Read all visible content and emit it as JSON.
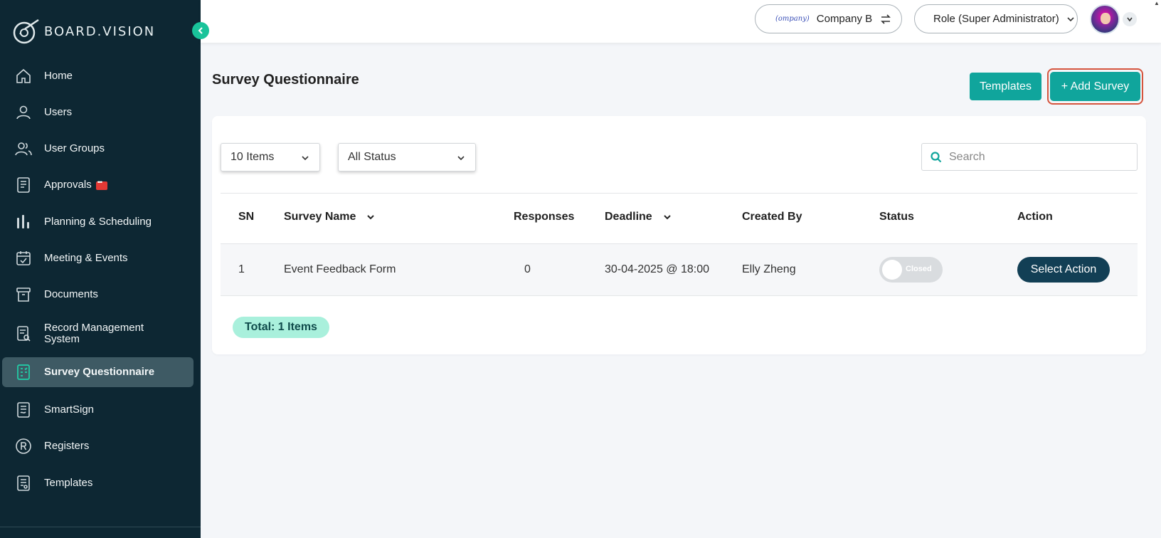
{
  "brand": {
    "name": "BOARD.VISION"
  },
  "sidebar": {
    "items": [
      {
        "label": "Home",
        "icon": "home-icon"
      },
      {
        "label": "Users",
        "icon": "user-icon"
      },
      {
        "label": "User Groups",
        "icon": "user-group-icon"
      },
      {
        "label": "Approvals",
        "icon": "approvals-icon"
      },
      {
        "label": "Planning & Scheduling",
        "icon": "bar-chart-icon"
      },
      {
        "label": "Meeting & Events",
        "icon": "calendar-icon"
      },
      {
        "label": "Documents",
        "icon": "archive-icon"
      },
      {
        "label": "Record Management System",
        "icon": "record-search-icon"
      },
      {
        "label": "Survey Questionnaire",
        "icon": "survey-icon",
        "active": true
      },
      {
        "label": "SmartSign",
        "icon": "smartsign-icon"
      },
      {
        "label": "Registers",
        "icon": "registered-icon"
      },
      {
        "label": "Templates",
        "icon": "templates-icon"
      }
    ]
  },
  "topbar": {
    "company_logo_text": "(ompany)",
    "company_name": "Company B",
    "role": "Role (Super Administrator)"
  },
  "page": {
    "title": "Survey Questionnaire",
    "templates_button": "Templates",
    "add_button": "+ Add Survey"
  },
  "filters": {
    "items_selected": "10 Items",
    "status_selected": "All Status",
    "search_placeholder": "Search"
  },
  "table": {
    "columns": [
      "SN",
      "Survey Name",
      "Responses",
      "Deadline",
      "Created By",
      "Status",
      "Action"
    ],
    "rows": [
      {
        "sn": "1",
        "name": "Event Feedback Form",
        "responses": "0",
        "deadline": "30-04-2025 @ 18:00",
        "created_by": "Elly Zheng",
        "status": "Closed",
        "action": "Select Action"
      }
    ],
    "total": "Total: 1 Items"
  },
  "colors": {
    "sidebar_bg": "#0d2733",
    "accent_teal": "#10a59c",
    "action_navy": "#123f55",
    "highlight_red": "#d5553e"
  }
}
